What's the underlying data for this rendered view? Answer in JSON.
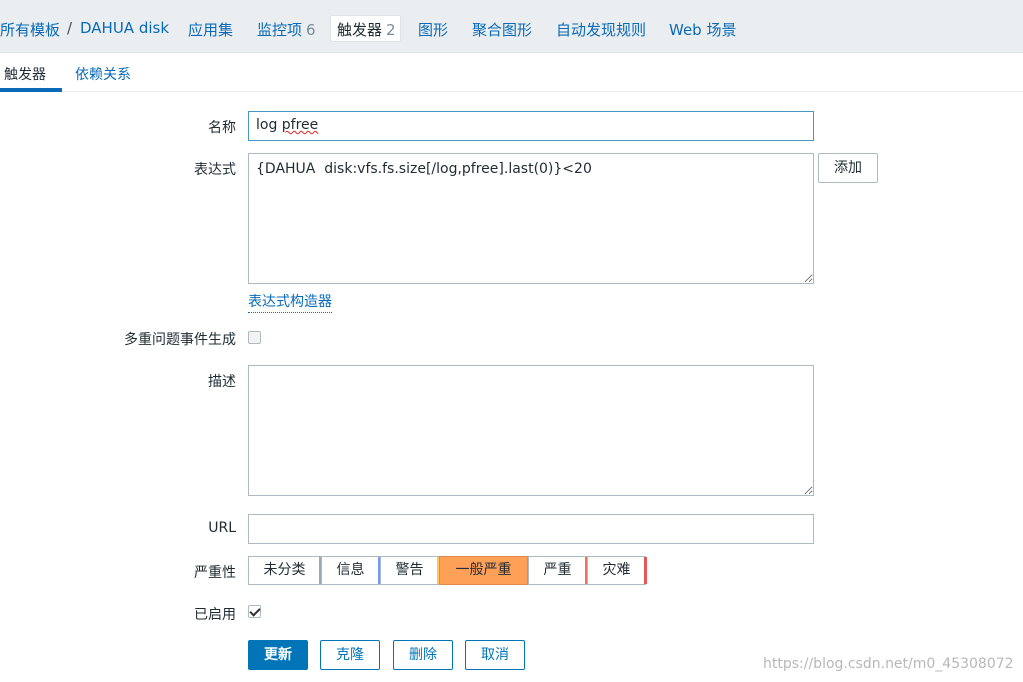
{
  "topnav": {
    "all_templates": "所有模板",
    "separator": "/",
    "template_name": "DAHUA disk",
    "applications": "应用集",
    "items": "监控项",
    "items_count": "6",
    "triggers": "触发器",
    "triggers_count": "2",
    "graphs": "图形",
    "screens": "聚合图形",
    "discovery": "自动发现规则",
    "web": "Web 场景"
  },
  "tabs": {
    "trigger": "触发器",
    "dependencies": "依赖关系"
  },
  "form": {
    "name_label": "名称",
    "name_value": "log pfree",
    "name_value_plain": "log ",
    "name_value_marked": "pfree",
    "expression_label": "表达式",
    "expression_value": "{DAHUA  disk:vfs.fs.size[/log,pfree].last(0)}<20",
    "add_button": "添加",
    "expression_constructor": "表达式构造器",
    "multiple_events_label": "多重问题事件生成",
    "multiple_events_checked": false,
    "description_label": "描述",
    "description_value": "",
    "url_label": "URL",
    "url_value": "",
    "severity_label": "严重性",
    "severities": [
      {
        "label": "未分类",
        "color": "#97aab3",
        "selected": false
      },
      {
        "label": "信息",
        "color": "#7499ff",
        "selected": false
      },
      {
        "label": "警告",
        "color": "#ffc859",
        "selected": false
      },
      {
        "label": "一般严重",
        "color": "#ffa059",
        "selected": true
      },
      {
        "label": "严重",
        "color": "#e97659",
        "selected": false
      },
      {
        "label": "灾难",
        "color": "#e45959",
        "selected": false
      }
    ],
    "enabled_label": "已启用",
    "enabled_checked": true
  },
  "actions": {
    "update": "更新",
    "clone": "克隆",
    "delete": "删除",
    "cancel": "取消"
  },
  "watermark": "https://blog.csdn.net/m0_45308072"
}
